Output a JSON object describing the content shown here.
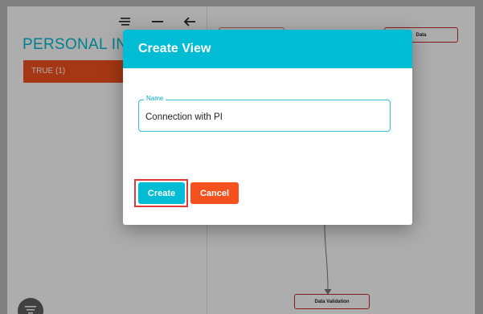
{
  "panel": {
    "title": "PERSONAL INFOR",
    "chip_label": "TRUE (1)",
    "toolbar_icons": [
      "list-icon",
      "minus-icon",
      "arrow-left-icon"
    ]
  },
  "canvas": {
    "nodes": {
      "data": "Data",
      "validation": "Data Validation"
    }
  },
  "dialog": {
    "title": "Create View",
    "name_label": "Name",
    "name_value": "Connection with PI",
    "create_label": "Create",
    "cancel_label": "Cancel"
  },
  "colors": {
    "accent": "#00bcd4",
    "danger": "#f4511e",
    "node_border": "#c62828",
    "highlight": "#e53935"
  }
}
